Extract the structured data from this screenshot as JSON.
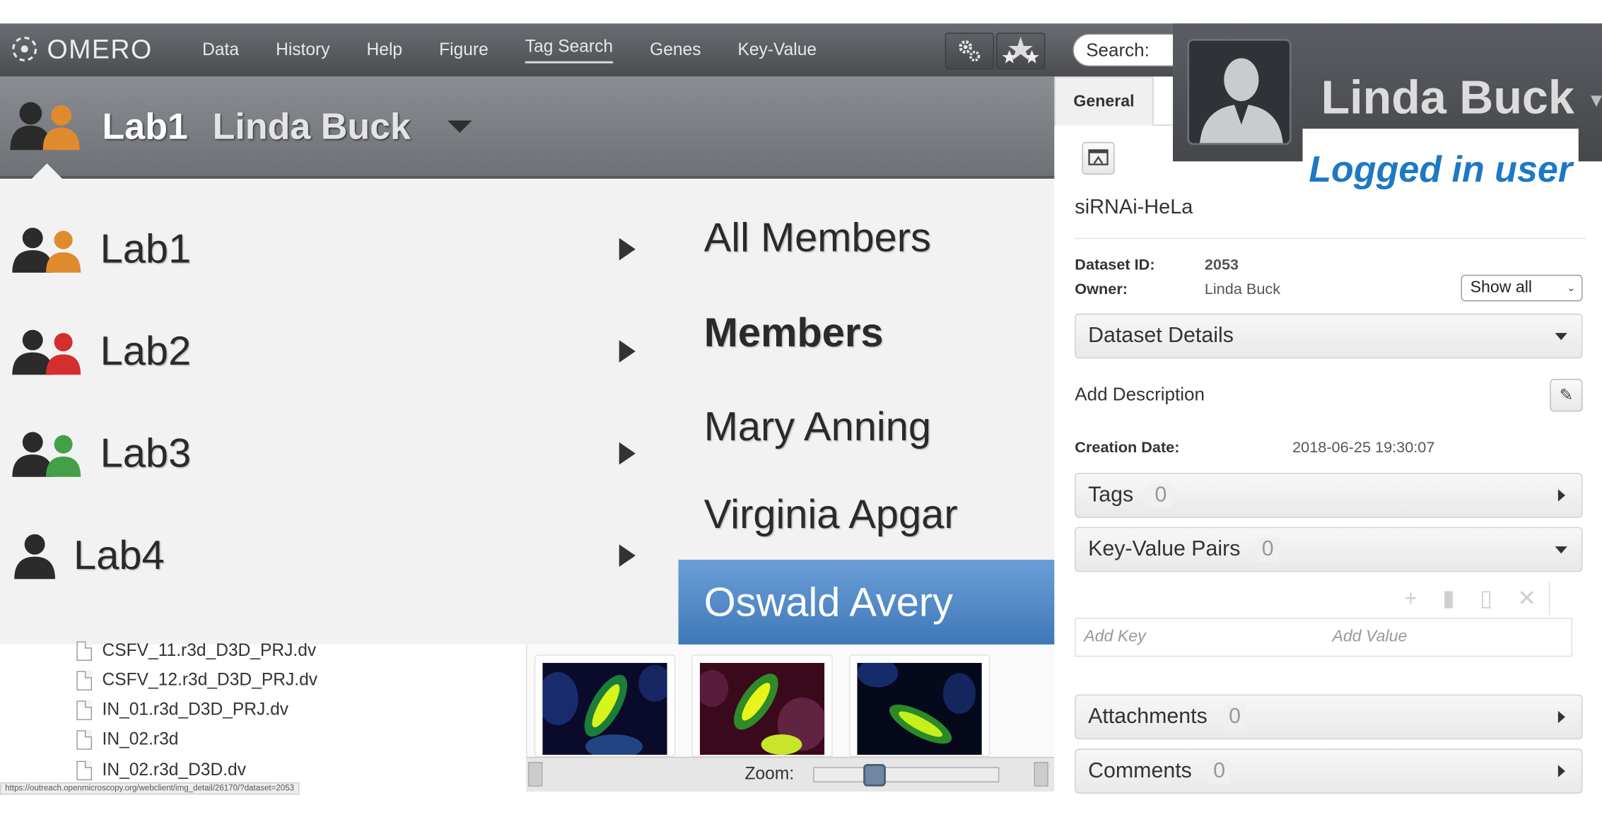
{
  "app": {
    "logo_text": "OMERO"
  },
  "nav": {
    "items": [
      {
        "label": "Data"
      },
      {
        "label": "History"
      },
      {
        "label": "Help"
      },
      {
        "label": "Figure"
      },
      {
        "label": "Tag Search"
      },
      {
        "label": "Genes"
      },
      {
        "label": "Key-Value"
      }
    ],
    "settings_icon": "gears-icon",
    "apps_icon": "stars-icon",
    "search_label": "Search:"
  },
  "user_panel": {
    "name": "Linda Buck",
    "callout": "Logged in user",
    "avatar_icon": "user-silhouette-icon"
  },
  "group_bar": {
    "current_group": "Lab1",
    "current_user": "Linda Buck"
  },
  "groups": [
    {
      "label": "Lab1",
      "color": "#e08a2e"
    },
    {
      "label": "Lab2",
      "color": "#d32f2f"
    },
    {
      "label": "Lab3",
      "color": "#43a047"
    },
    {
      "label": "Lab4",
      "color": ""
    }
  ],
  "members_menu": {
    "all_members": "All Members",
    "heading": "Members",
    "items": [
      "Mary Anning",
      "Virginia Apgar",
      "Oswald Avery"
    ],
    "selected": "Oswald Avery"
  },
  "files": [
    "CSFV_11.r3d_D3D_PRJ.dv",
    "CSFV_12.r3d_D3D_PRJ.dv",
    "IN_01.r3d_D3D_PRJ.dv",
    "IN_02.r3d",
    "IN_02.r3d_D3D.dv"
  ],
  "status_url": "https://outreach.openmicroscopy.org/webclient/img_detail/26170/?dataset=2053",
  "thumbnails": {
    "zoom_label": "Zoom:",
    "zoom_level": 0.3
  },
  "right_panel": {
    "tab_general": "General",
    "dataset_name": "siRNAi-HeLa",
    "dataset_id_label": "Dataset ID:",
    "dataset_id": "2053",
    "owner_label": "Owner:",
    "owner": "Linda Buck",
    "show_select": "Show all",
    "dataset_details": "Dataset Details",
    "add_description": "Add Description",
    "creation_date_label": "Creation Date:",
    "creation_date": "2018-06-25 19:30:07",
    "tags_label": "Tags",
    "tags_count": "0",
    "kv_label": "Key-Value Pairs",
    "kv_count": "0",
    "add_key": "Add Key",
    "add_value": "Add Value",
    "attachments_label": "Attachments",
    "attachments_count": "0",
    "comments_label": "Comments",
    "comments_count": "0"
  }
}
